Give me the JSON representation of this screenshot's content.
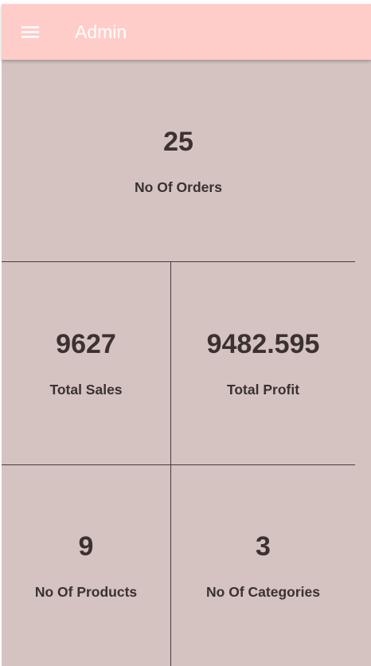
{
  "appbar": {
    "title": "Admin",
    "menu_icon": "hamburger-menu-icon",
    "background": "#ffcdc9"
  },
  "dashboard": {
    "background": "#d4c3c1",
    "text_color": "#3b3131",
    "orders": {
      "value": "25",
      "label": "No Of Orders"
    },
    "sales": {
      "value": "9627",
      "label": "Total Sales"
    },
    "profit": {
      "value": "9482.595",
      "label": "Total Profit"
    },
    "products": {
      "value": "9",
      "label": "No Of Products"
    },
    "categories": {
      "value": "3",
      "label": "No Of Categories"
    }
  }
}
